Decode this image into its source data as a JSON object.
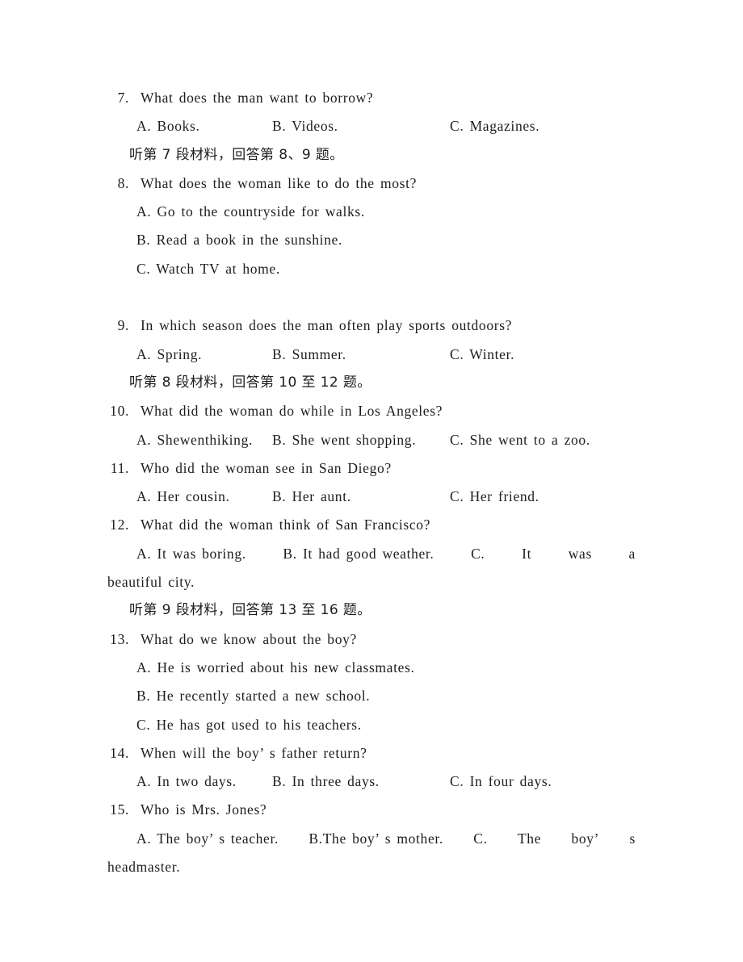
{
  "document": {
    "type": "exam-paper",
    "language": "English listening comprehension with Chinese instructions",
    "background_color": "#ffffff",
    "text_color": "#1d1d1d"
  },
  "questions": [
    {
      "number": "7.",
      "stem": "What does the man want to borrow?",
      "layout": "three-column",
      "options": [
        {
          "label": "A.",
          "text": "Books."
        },
        {
          "label": "B.",
          "text": "Videos."
        },
        {
          "label": "C.",
          "text": "Magazines."
        }
      ]
    },
    {
      "number": "8.",
      "stem": "What does the woman like to do the most?",
      "layout": "stacked",
      "options": [
        {
          "label": "A.",
          "text": "Go to the countryside for walks."
        },
        {
          "label": "B.",
          "text": "Read a book in the sunshine."
        },
        {
          "label": "C.",
          "text": "Watch TV at home."
        }
      ]
    },
    {
      "number": "9.",
      "stem": "In which season does the man often play sports outdoors?",
      "layout": "three-column",
      "options": [
        {
          "label": "A.",
          "text": "Spring."
        },
        {
          "label": "B.",
          "text": "Summer."
        },
        {
          "label": "C.",
          "text": "Winter."
        }
      ]
    },
    {
      "number": "10.",
      "stem": "What did the woman do while in Los Angeles?",
      "layout": "three-column",
      "options": [
        {
          "label": "A.",
          "text": "Shewenthiking."
        },
        {
          "label": "B.",
          "text": "She went shopping."
        },
        {
          "label": "C.",
          "text": "She went to a zoo."
        }
      ]
    },
    {
      "number": "11.",
      "stem": "Who did the woman see in San Diego?",
      "layout": "three-column",
      "options": [
        {
          "label": "A.",
          "text": "Her cousin."
        },
        {
          "label": "B.",
          "text": "Her aunt."
        },
        {
          "label": "C.",
          "text": "Her friend."
        }
      ]
    },
    {
      "number": "12.",
      "stem": "What did the woman think of San Francisco?",
      "layout": "three-column-wrapped",
      "options": [
        {
          "label": "A.",
          "text": "It was boring."
        },
        {
          "label": "B.",
          "text": "It had good weather."
        },
        {
          "label": "C.",
          "text": "It was a beautiful city."
        }
      ],
      "wrapped_line_parts": [
        "C.",
        "It",
        "was",
        "a"
      ],
      "wrapped_continuation": "beautiful city."
    },
    {
      "number": "13.",
      "stem": "What do we know about the boy?",
      "layout": "stacked",
      "options": [
        {
          "label": "A.",
          "text": "He is worried about his new classmates."
        },
        {
          "label": "B.",
          "text": "He recently started a new school."
        },
        {
          "label": "C.",
          "text": "He has got used to his teachers."
        }
      ]
    },
    {
      "number": "14.",
      "stem": "When will the boy’ s father return?",
      "layout": "three-column",
      "options": [
        {
          "label": "A.",
          "text": "In two days."
        },
        {
          "label": "B.",
          "text": "In three days."
        },
        {
          "label": "C.",
          "text": "In four days."
        }
      ]
    },
    {
      "number": "15.",
      "stem": "Who is Mrs. Jones?",
      "layout": "three-column-wrapped",
      "options": [
        {
          "label": "A.",
          "text": "The boy’ s teacher."
        },
        {
          "label": "B.",
          "text": "The boy’ s mother."
        },
        {
          "label": "C.",
          "text": "The boy’ s headmaster."
        }
      ],
      "option_a_full": "A. The boy’ s teacher.",
      "option_b_full": "B.The boy’ s mother.",
      "wrapped_line_parts": [
        "C.",
        "The",
        "boy’",
        "s"
      ],
      "wrapped_continuation": "headmaster."
    }
  ],
  "instructions": [
    {
      "id": "ins7",
      "text": "听第 7 段材料，回答第 8、9 题。"
    },
    {
      "id": "ins8",
      "text": "听第 8 段材料，回答第 10 至 12 题。"
    },
    {
      "id": "ins9",
      "text": "听第 9 段材料，回答第 13 至 16 题。"
    }
  ],
  "rendered_lines": {
    "q7_stem_num": "7.",
    "q7_stem_text": "What does the man want to borrow?",
    "q7_opt_a": "A. Books.",
    "q7_opt_b": "B. Videos.",
    "q7_opt_c": "C. Magazines.",
    "q8_stem_num": "8.",
    "q8_stem_text": "What does the woman like to do the most?",
    "q8_opt_a": "A. Go to the countryside for walks.",
    "q8_opt_b": "B. Read a book in the sunshine.",
    "q8_opt_c": "C. Watch TV at home.",
    "q9_stem_num": "9.",
    "q9_stem_text": "In which season does the man often play sports outdoors?",
    "q9_opt_a": "A. Spring.",
    "q9_opt_b": "B. Summer.",
    "q9_opt_c": "C. Winter.",
    "q10_stem_num": "10.",
    "q10_stem_text": "What did the woman do while in Los Angeles?",
    "q10_opt_a": "A. Shewenthiking.",
    "q10_opt_b": "B. She went shopping.",
    "q10_opt_c": "C. She went to a zoo.",
    "q11_stem_num": "11.",
    "q11_stem_text": "Who did the woman see in San Diego?",
    "q11_opt_a": "A. Her cousin.",
    "q11_opt_b": "B. Her aunt.",
    "q11_opt_c": "C. Her friend.",
    "q12_stem_num": "12.",
    "q12_stem_text": "What did the woman think of San Francisco?",
    "q12_opt_a": "A. It was boring.",
    "q12_opt_b": "B. It had good weather.",
    "q12_opt_c_p1": "C.",
    "q12_opt_c_p2": "It",
    "q12_opt_c_p3": "was",
    "q12_opt_c_p4": "a",
    "q12_opt_c_cont": "beautiful city.",
    "q13_stem_num": "13.",
    "q13_stem_text": "What do we know about the boy?",
    "q13_opt_a": "A. He is worried about his new classmates.",
    "q13_opt_b": "B. He recently started a new school.",
    "q13_opt_c": "C. He has got used to his teachers.",
    "q14_stem_num": "14.",
    "q14_stem_text": "When will the boy’ s father return?",
    "q14_opt_a": "A. In two days.",
    "q14_opt_b": "B. In three days.",
    "q14_opt_c": "C. In four days.",
    "q15_stem_num": "15.",
    "q15_stem_text": "Who is Mrs. Jones?",
    "q15_opt_a": "A. The boy’ s teacher.",
    "q15_opt_b": "B.The boy’ s mother.",
    "q15_opt_c_p1": "C.",
    "q15_opt_c_p2": "The",
    "q15_opt_c_p3": "boy’",
    "q15_opt_c_p4": "s",
    "q15_opt_c_cont": "headmaster."
  }
}
